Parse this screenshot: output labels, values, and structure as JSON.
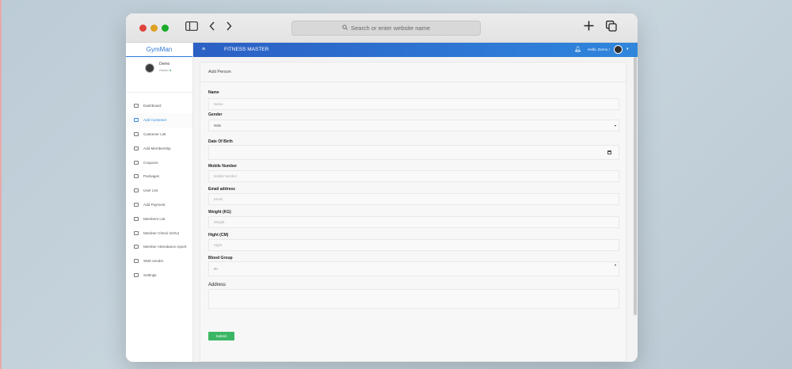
{
  "browser": {
    "address_placeholder": "Search or enter website name"
  },
  "sidebar": {
    "brand": "GymMan",
    "profile": {
      "name": "Demo",
      "role": "Owner",
      "status_icon": "online-dot"
    },
    "items": [
      {
        "label": "Dashboard",
        "icon": "dashboard-icon"
      },
      {
        "label": "Add Customer",
        "icon": "add-user-icon",
        "active": true
      },
      {
        "label": "Customer List",
        "icon": "users-icon"
      },
      {
        "label": "Add Membership",
        "icon": "membership-icon"
      },
      {
        "label": "Coupons",
        "icon": "coupon-icon"
      },
      {
        "label": "Packages",
        "icon": "list-icon"
      },
      {
        "label": "User List",
        "icon": "users-icon"
      },
      {
        "label": "Add Payment",
        "icon": "payment-icon"
      },
      {
        "label": "Members List",
        "icon": "card-icon"
      },
      {
        "label": "Member Check In/Out",
        "icon": "card-icon"
      },
      {
        "label": "Member Attendance report",
        "icon": "card-icon"
      },
      {
        "label": "SMS sender",
        "icon": "sms-icon"
      },
      {
        "label": "Settings",
        "icon": "flag-icon"
      }
    ]
  },
  "topbar": {
    "title": "FITNESS MASTER",
    "greeting": "Hello, Demo !"
  },
  "form": {
    "title": "Add Person",
    "fields": {
      "name": {
        "label": "Name",
        "placeholder": "Name"
      },
      "gender": {
        "label": "Gender",
        "value": "Male"
      },
      "dob": {
        "label": "Date Of Birth"
      },
      "mobile": {
        "label": "Mobile Number",
        "placeholder": "Mobile Number"
      },
      "email": {
        "label": "Email address",
        "placeholder": "Email"
      },
      "weight": {
        "label": "Weight (KG)",
        "placeholder": "Weight"
      },
      "height": {
        "label": "Hight (CM)",
        "placeholder": "Hight"
      },
      "blood": {
        "label": "Blood Group",
        "value": "A+"
      },
      "address": {
        "label": "Address"
      }
    },
    "submit_label": "Submit"
  },
  "colors": {
    "accent": "#2f77d6",
    "submit": "#3cb664"
  }
}
